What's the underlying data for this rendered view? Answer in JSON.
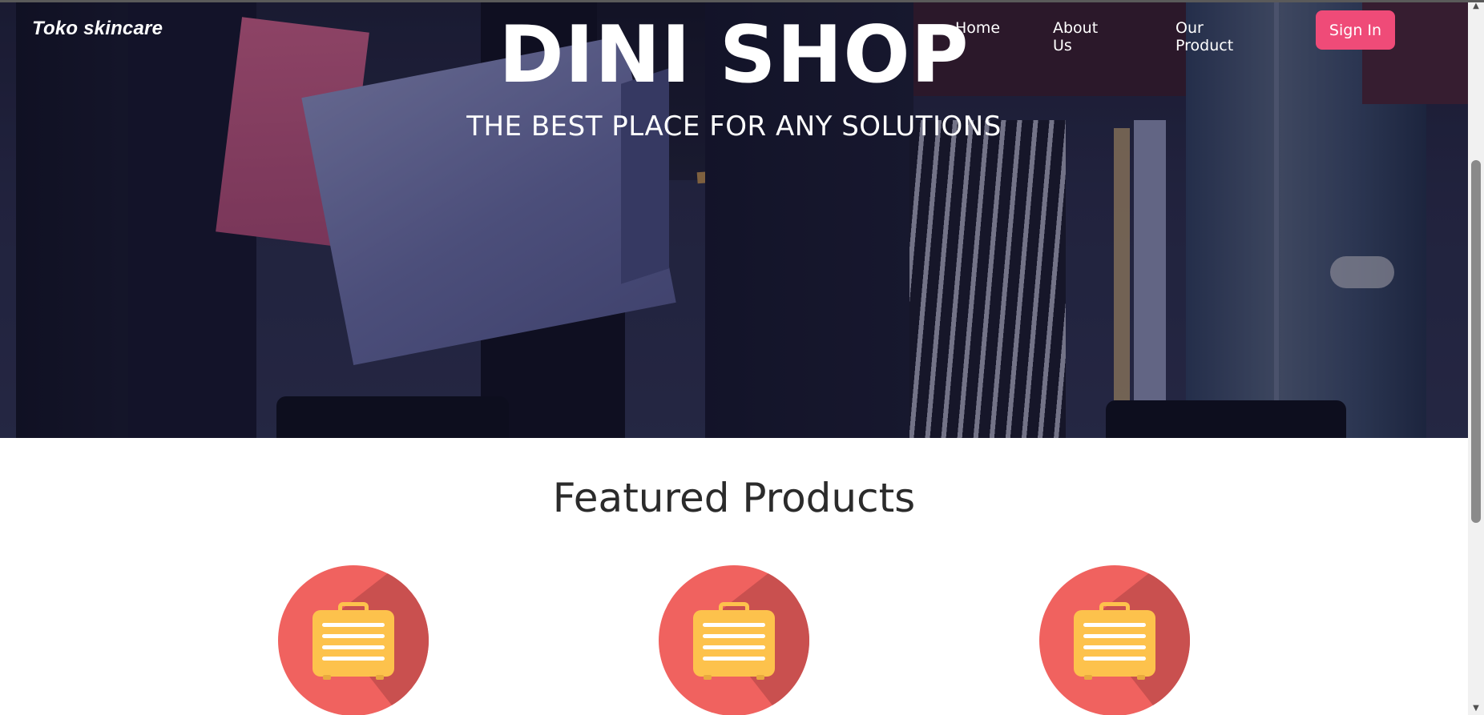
{
  "nav": {
    "brand": "Toko skincare",
    "links": [
      "Home",
      "About Us",
      "Our Product"
    ],
    "signin_label": "Sign In"
  },
  "hero": {
    "title": "DINI SHOP",
    "subtitle": "THE BEST PLACE FOR ANY SOLUTIONS"
  },
  "featured": {
    "title": "Featured Products",
    "products": [
      {
        "icon": "briefcase-icon"
      },
      {
        "icon": "briefcase-icon"
      },
      {
        "icon": "briefcase-icon"
      }
    ]
  },
  "colors": {
    "accent": "#ef4b78",
    "product_circle": "#f0625f",
    "product_icon": "#fdc24c"
  },
  "scrollbar": {
    "up_icon": "▲",
    "down_icon": "▼"
  }
}
